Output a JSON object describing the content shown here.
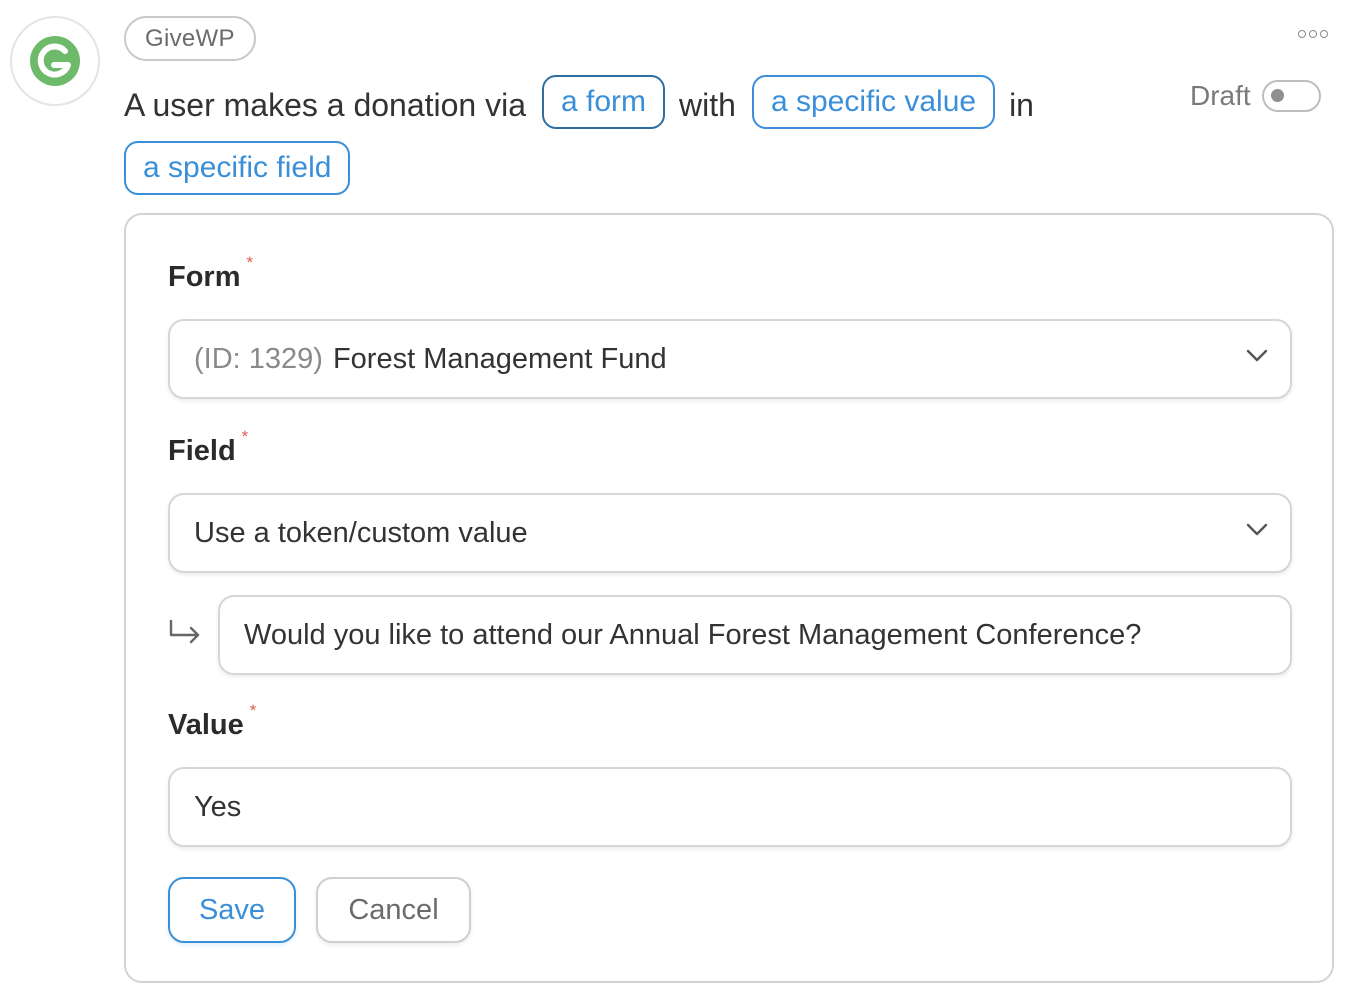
{
  "integration": {
    "badge": "GiveWP",
    "logo_icon": "givewp-logo-icon",
    "brand_color": "#6dba6a"
  },
  "recipe": {
    "status_label": "Draft",
    "status_enabled": false
  },
  "trigger": {
    "text_1": "A user makes a donation via",
    "token_form": "a form",
    "text_2": "with",
    "token_value": "a specific value",
    "text_3": "in",
    "token_field": "a specific field"
  },
  "panel": {
    "form": {
      "label": "Form",
      "required_mark": "*",
      "selected_id": "(ID: 1329)",
      "selected_name": "Forest Management Fund"
    },
    "field": {
      "label": "Field",
      "required_mark": "*",
      "selected": "Use a token/custom value",
      "custom_value": "Would you like to attend our Annual Forest Management Conference?"
    },
    "value": {
      "label": "Value",
      "required_mark": "*",
      "current": "Yes"
    },
    "save_label": "Save",
    "cancel_label": "Cancel"
  },
  "colors": {
    "accent": "#3b8fd9",
    "required": "#e05a4f",
    "border": "#d6d6d6"
  }
}
